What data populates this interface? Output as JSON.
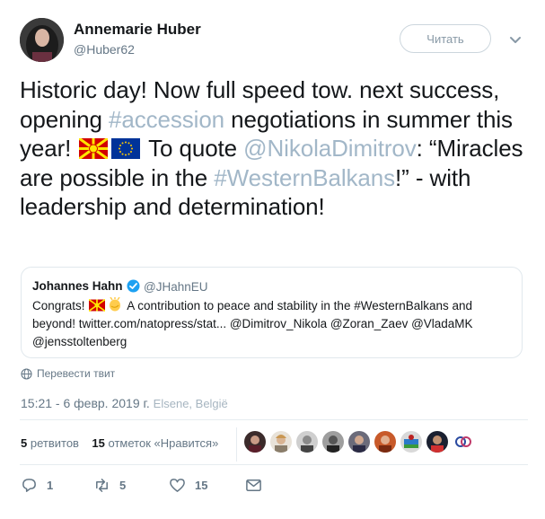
{
  "author": {
    "name": "Annemarie Huber",
    "handle": "@Huber62"
  },
  "follow_button": "Читать",
  "tweet": {
    "t1": "Historic day! Now full speed tow. next success, opening ",
    "hash1": "#accession",
    "t2": " negotiations in summer this year! ",
    "t3": " To quote ",
    "mention1": "@NikolaDimitrov",
    "t4": ": “Miracles are possible in the ",
    "hash2": "#WesternBalkans",
    "t5": "!” - with leadership and determination!"
  },
  "quoted": {
    "name": "Johannes Hahn",
    "handle": "@JHahnEU",
    "text_start": "Congrats! ",
    "text_rest": " A contribution to peace and stability in the #WesternBalkans and beyond! twitter.com/natopress/stat... @Dimitrov_Nikola @Zoran_Zaev @VladaMK @jensstoltenberg"
  },
  "translate_label": "Перевести твит",
  "timestamp": "15:21 - 6 февр. 2019 г.",
  "location": "Elsene, België",
  "stats": {
    "retweets_count": "5",
    "retweets_label": "ретвитов",
    "likes_count": "15",
    "likes_label": "отметок «Нравится»"
  },
  "actions": {
    "reply_count": "1",
    "retweet_count": "5",
    "like_count": "15"
  },
  "colors": {
    "link": "#a2b7c8",
    "secondary": "#657786",
    "verified": "#1da1f2"
  },
  "icons": [
    "chevron-down-icon",
    "verified-icon",
    "globe-icon",
    "reply-icon",
    "retweet-icon",
    "heart-icon",
    "message-icon",
    "macedonia-flag-icon",
    "eu-flag-icon",
    "clapping-hands-icon"
  ]
}
